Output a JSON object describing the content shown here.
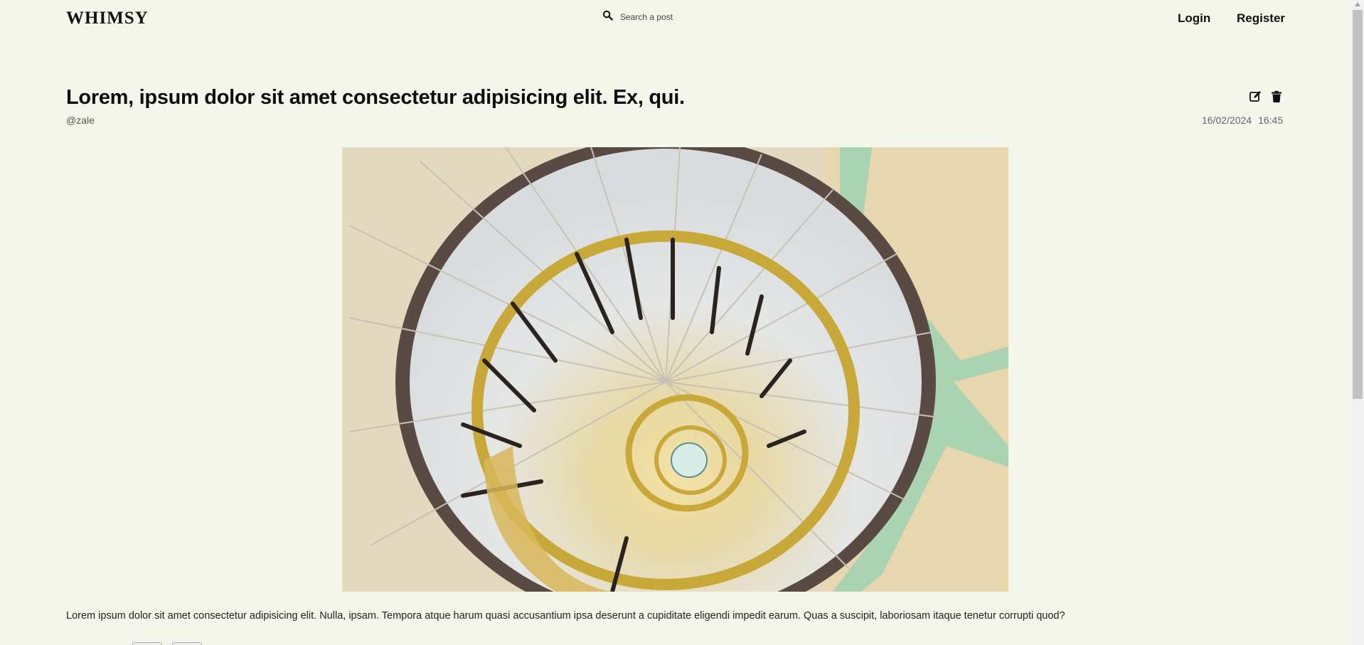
{
  "header": {
    "logo": "WHIMSY",
    "search_placeholder": "Search a post",
    "nav": {
      "login": "Login",
      "register": "Register"
    }
  },
  "post": {
    "title": "Lorem, ipsum dolor sit amet consectetur adipisicing elit. Ex, qui.",
    "author": "@zale",
    "date": "16/02/2024",
    "time": "16:45",
    "body": "Lorem ipsum dolor sit amet consectetur adipisicing elit. Nulla, ipsam. Tempora atque harum quasi accusantium ipsa deserunt a cupiditate eligendi impedit earum. Quas a suscipit, laboriosam itaque tenetur corrupti quod?",
    "actions": [
      "edit-icon",
      "trash-icon"
    ]
  },
  "colors": {
    "background": "#f4f6ec",
    "text": "#111111",
    "muted": "#666666"
  }
}
